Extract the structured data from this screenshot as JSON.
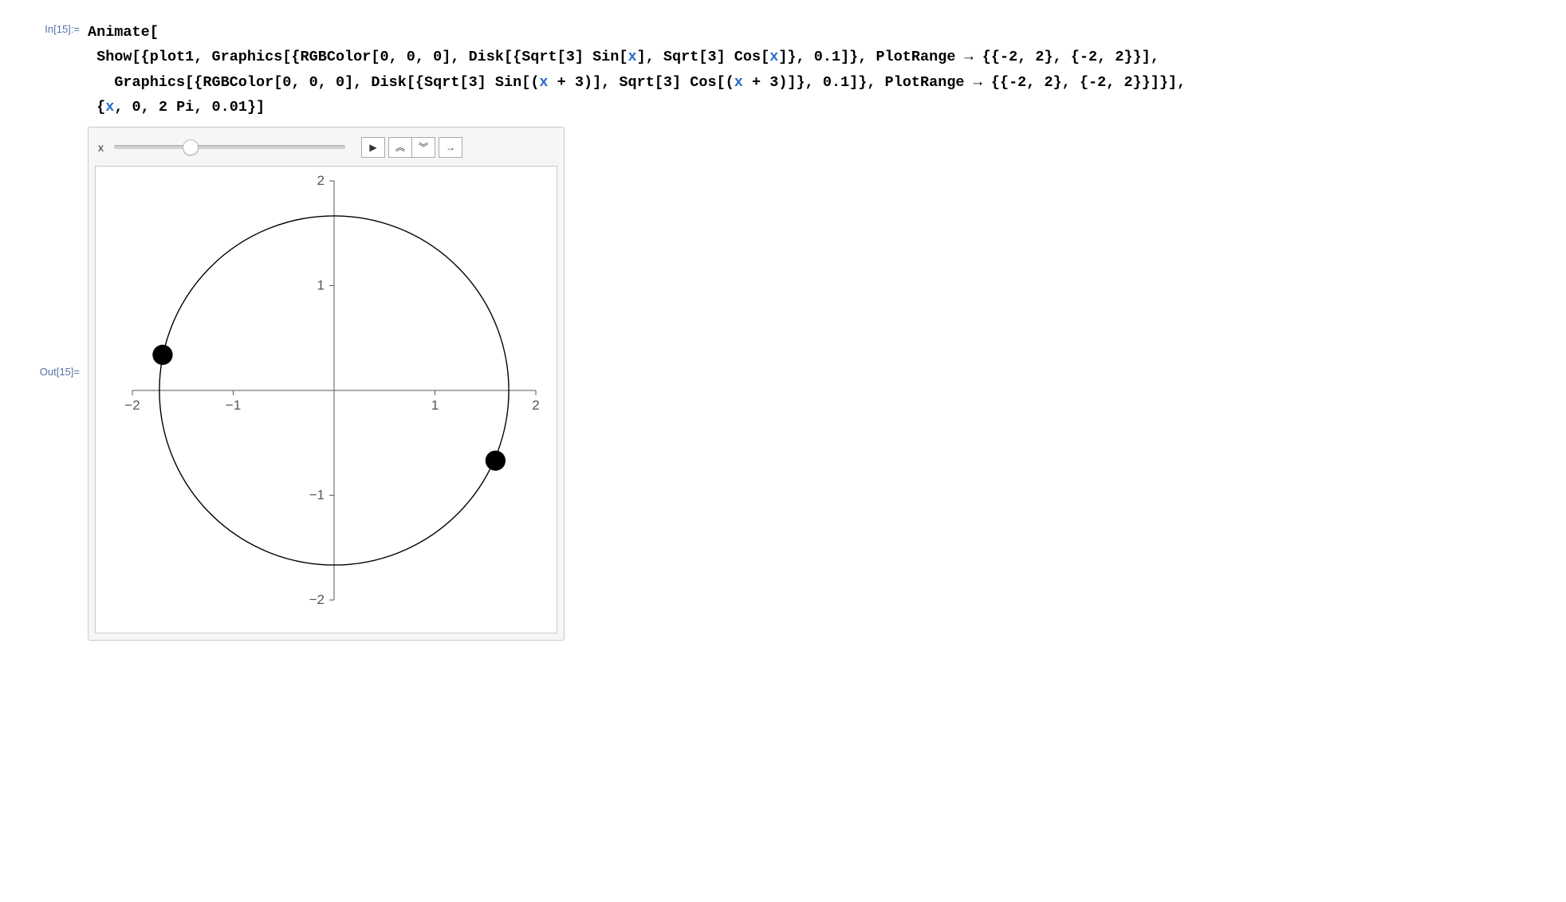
{
  "labels": {
    "in_label": "In[15]:=",
    "out_label": "Out[15]="
  },
  "code": {
    "fn": "Animate",
    "show": "Show",
    "graphics": "Graphics",
    "rgb": "RGBColor",
    "disk": "Disk",
    "sqrt": "Sqrt",
    "sin": "Sin",
    "cos": "Cos",
    "plotrange": "PlotRange",
    "plot1": "plot1",
    "var_x": "x",
    "num0": "0",
    "num3": "3",
    "num01": "0.1",
    "numm2": "-2",
    "num2": "2",
    "num2pi": "2 Pi",
    "num001": "0.01",
    "arrow": "→",
    "open": "[",
    "close": "]",
    "bopen": "{",
    "bclose": "}",
    "popen": "(",
    "pclose": ")",
    "comma": ", ",
    "commaS": ",",
    "plus": " + "
  },
  "control": {
    "var_label": "x",
    "slider_percent": 33,
    "play_icon": "▶",
    "faster_icon": "︽",
    "slower_icon": "︾",
    "dir_icon": "→"
  },
  "chart_data": {
    "type": "scatter",
    "title": "",
    "xlabel": "",
    "ylabel": "",
    "xlim": [
      -2,
      2
    ],
    "ylim": [
      -2,
      2
    ],
    "xticks": [
      -2,
      -1,
      1,
      2
    ],
    "yticks": [
      -2,
      -1,
      1,
      2
    ],
    "circle": {
      "cx": 0,
      "cy": 0,
      "r": 1.732
    },
    "points": [
      {
        "x": -1.7,
        "y": 0.34,
        "r": 0.1
      },
      {
        "x": 1.6,
        "y": -0.67,
        "r": 0.1
      }
    ]
  }
}
